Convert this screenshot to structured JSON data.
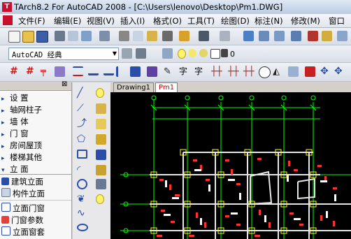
{
  "window": {
    "title": "TArch8.2 For AutoCAD 2008 - [C:\\Users\\lenovo\\Desktop\\Pm1.DWG]"
  },
  "menu": [
    "文件(F)",
    "编辑(E)",
    "视图(V)",
    "插入(I)",
    "格式(O)",
    "工具(T)",
    "绘图(D)",
    "标注(N)",
    "修改(M)",
    "窗口"
  ],
  "workspace": {
    "selected": "AutoCAD 经典"
  },
  "layer": {
    "value": "0"
  },
  "panel": {
    "items": [
      {
        "label": "设    置",
        "arrow": "▸"
      },
      {
        "label": "轴网柱子",
        "arrow": "▸"
      },
      {
        "label": "墙    体",
        "arrow": "▸"
      },
      {
        "label": "门    窗",
        "arrow": "▸"
      },
      {
        "label": "房间屋顶",
        "arrow": "▸"
      },
      {
        "label": "楼梯其他",
        "arrow": "▸"
      },
      {
        "label": "立    面",
        "arrow": "▾"
      }
    ],
    "subitems": [
      "建筑立面",
      "构件立面",
      "立面门窗",
      "门窗参数",
      "立面窗套"
    ]
  },
  "tabs": [
    "Drawing1",
    "Pm1"
  ],
  "colors": {
    "canvas": "#000000",
    "axis": "#00ff00",
    "wall": "#ffffff",
    "column": "#ffff00",
    "dim": "#ff3333"
  }
}
